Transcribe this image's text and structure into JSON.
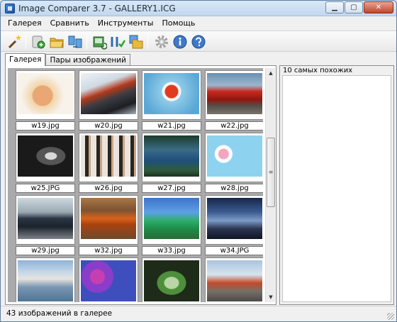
{
  "window": {
    "title": "Image Comparer 3.7 - GALLERY1.ICG"
  },
  "menu": [
    "Галерея",
    "Сравнить",
    "Инструменты",
    "Помощь"
  ],
  "toolbar": {
    "buttons": [
      "magic-wand-icon",
      "add-gallery-icon",
      "open-folder-icon",
      "compare-icon",
      "refresh-gallery-icon",
      "compare-pairs-icon",
      "open-pairs-icon",
      "settings-icon",
      "info-icon",
      "help-icon"
    ]
  },
  "tabs": [
    "Галерея",
    "Пары изображений"
  ],
  "gallery": {
    "items": [
      {
        "label": "w19.jpg"
      },
      {
        "label": "w20.jpg"
      },
      {
        "label": "w21.jpg"
      },
      {
        "label": "w22.jpg"
      },
      {
        "label": "w25.JPG"
      },
      {
        "label": "w26.jpg"
      },
      {
        "label": "w27.jpg"
      },
      {
        "label": "w28.jpg"
      },
      {
        "label": "w29.jpg"
      },
      {
        "label": "w32.jpg"
      },
      {
        "label": "w33.jpg"
      },
      {
        "label": "w34.JPG"
      },
      {
        "label": ""
      },
      {
        "label": ""
      },
      {
        "label": ""
      },
      {
        "label": ""
      }
    ]
  },
  "similar_panel": {
    "title": "10 самых похожих"
  },
  "status": {
    "text": "43 изображений в галерее"
  }
}
